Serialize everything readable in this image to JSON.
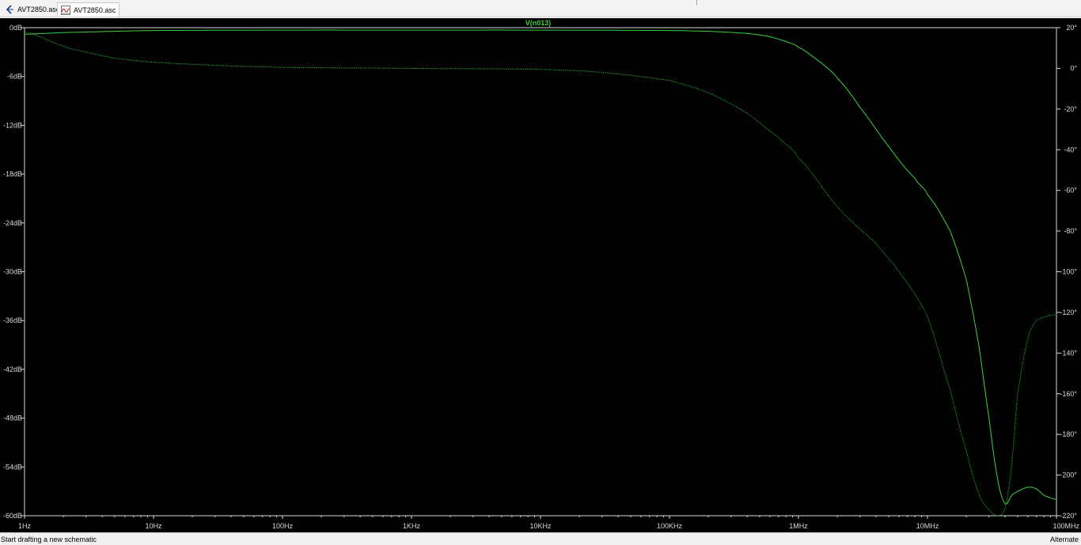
{
  "tabs": [
    {
      "label": "AVT2850.asc",
      "icon": "schematic-icon",
      "active": false
    },
    {
      "label": "AVT2850.asc",
      "icon": "waveform-icon",
      "active": true
    }
  ],
  "status": {
    "left": "Start drafting a new schematic",
    "right": "Alternate"
  },
  "colors": {
    "background": "#000000",
    "axis": "#d8d8d8",
    "trace": "#3cd23c"
  },
  "chart_data": {
    "type": "line",
    "title": "V(n013)",
    "x_scale": "log",
    "xlim": [
      1,
      100000000
    ],
    "x_ticks": [
      {
        "value": 1,
        "label": "1Hz"
      },
      {
        "value": 10,
        "label": "10Hz"
      },
      {
        "value": 100,
        "label": "100Hz"
      },
      {
        "value": 1000,
        "label": "1KHz"
      },
      {
        "value": 10000,
        "label": "10KHz"
      },
      {
        "value": 100000,
        "label": "100KHz"
      },
      {
        "value": 1000000,
        "label": "1MHz"
      },
      {
        "value": 10000000,
        "label": "10MHz"
      },
      {
        "value": 100000000,
        "label": "100MHz"
      }
    ],
    "ylim_left": [
      -60,
      0
    ],
    "y_ticks_left": [
      {
        "value": 0,
        "label": "0dB"
      },
      {
        "value": -6,
        "label": "-6dB"
      },
      {
        "value": -12,
        "label": "-12dB"
      },
      {
        "value": -18,
        "label": "-18dB"
      },
      {
        "value": -24,
        "label": "-24dB"
      },
      {
        "value": -30,
        "label": "-30dB"
      },
      {
        "value": -36,
        "label": "-36dB"
      },
      {
        "value": -42,
        "label": "-42dB"
      },
      {
        "value": -48,
        "label": "-48dB"
      },
      {
        "value": -54,
        "label": "-54dB"
      },
      {
        "value": -60,
        "label": "-60dB"
      }
    ],
    "ylim_right": [
      -220,
      20
    ],
    "y_ticks_right": [
      {
        "value": 20,
        "label": "20°"
      },
      {
        "value": 0,
        "label": "0°"
      },
      {
        "value": -20,
        "label": "-20°"
      },
      {
        "value": -40,
        "label": "-40°"
      },
      {
        "value": -60,
        "label": "-60°"
      },
      {
        "value": -80,
        "label": "-80°"
      },
      {
        "value": -100,
        "label": "-100°"
      },
      {
        "value": -120,
        "label": "-120°"
      },
      {
        "value": -140,
        "label": "-140°"
      },
      {
        "value": -160,
        "label": "-160°"
      },
      {
        "value": -180,
        "label": "-180°"
      },
      {
        "value": -200,
        "label": "-200°"
      },
      {
        "value": -220,
        "label": "-220°"
      }
    ],
    "series": [
      {
        "axis": "left",
        "style": "solid",
        "x": [
          1,
          2,
          5,
          10,
          100,
          1000,
          10000,
          100000,
          200000,
          400000,
          600000,
          800000,
          1000000,
          1500000,
          2000000,
          3000000,
          5000000,
          8000000,
          10000000,
          15000000,
          20000000,
          25000000,
          30000000,
          35000000,
          40000000,
          45000000,
          50000000,
          60000000,
          70000000,
          80000000,
          100000000
        ],
        "values": [
          -0.8,
          -0.6,
          -0.45,
          -0.35,
          -0.3,
          -0.3,
          -0.3,
          -0.35,
          -0.45,
          -0.7,
          -1.1,
          -1.7,
          -2.4,
          -4.3,
          -6.2,
          -9.8,
          -14.6,
          -18.5,
          -20.5,
          -25.0,
          -31.0,
          -39.0,
          -48.0,
          -55.5,
          -58.5,
          -57.5,
          -57.0,
          -56.5,
          -56.7,
          -57.5,
          -58.0
        ]
      },
      {
        "axis": "right",
        "style": "dotted",
        "x": [
          1,
          2,
          3,
          5,
          10,
          30,
          100,
          1000,
          10000,
          30000,
          100000,
          200000,
          400000,
          700000,
          1000000,
          2000000,
          4000000,
          6000000,
          10000000,
          15000000,
          20000000,
          25000000,
          30000000,
          35000000,
          40000000,
          45000000,
          50000000,
          60000000,
          70000000,
          100000000
        ],
        "values": [
          18,
          11,
          8,
          5,
          3,
          1.5,
          0.5,
          0,
          -0.5,
          -2,
          -6,
          -12,
          -22,
          -34,
          -44,
          -68,
          -86,
          -100,
          -122,
          -158,
          -188,
          -209,
          -217,
          -220,
          -216,
          -195,
          -160,
          -133,
          -124,
          -121
        ]
      }
    ]
  }
}
